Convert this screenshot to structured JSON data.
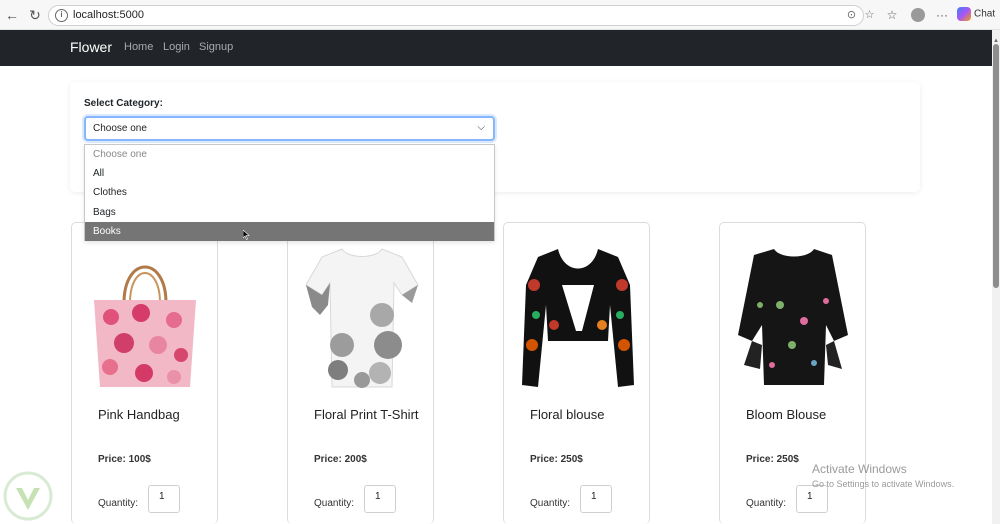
{
  "browser": {
    "url": "localhost:5000",
    "chat_label": "Chat"
  },
  "navbar": {
    "brand": "Flower",
    "links": [
      "Home",
      "Login",
      "Signup"
    ]
  },
  "filter": {
    "label": "Select Category:",
    "selected": "Choose one",
    "options": [
      "Choose one",
      "All",
      "Clothes",
      "Bags",
      "Books"
    ],
    "highlighted_option": "Books"
  },
  "products": [
    {
      "name": "Pink Handbag",
      "price": "Price: 100$",
      "quantity_label": "Quantity:",
      "quantity": "1",
      "image_icon": "handbag-icon"
    },
    {
      "name": "Floral Print T-Shirt",
      "price": "Price: 200$",
      "quantity_label": "Quantity:",
      "quantity": "1",
      "image_icon": "tshirt-icon"
    },
    {
      "name": "Floral blouse",
      "price": "Price: 250$",
      "quantity_label": "Quantity:",
      "quantity": "1",
      "image_icon": "blouse-icon"
    },
    {
      "name": "Bloom Blouse",
      "price": "Price: 250$",
      "quantity_label": "Quantity:",
      "quantity": "1",
      "image_icon": "blouse-icon"
    }
  ],
  "watermark": {
    "title": "Activate Windows",
    "subtitle": "Go to Settings to activate Windows."
  },
  "colors": {
    "navbar_bg": "#212529",
    "highlight_bg": "#757575",
    "focus_border": "#86b7fe"
  }
}
